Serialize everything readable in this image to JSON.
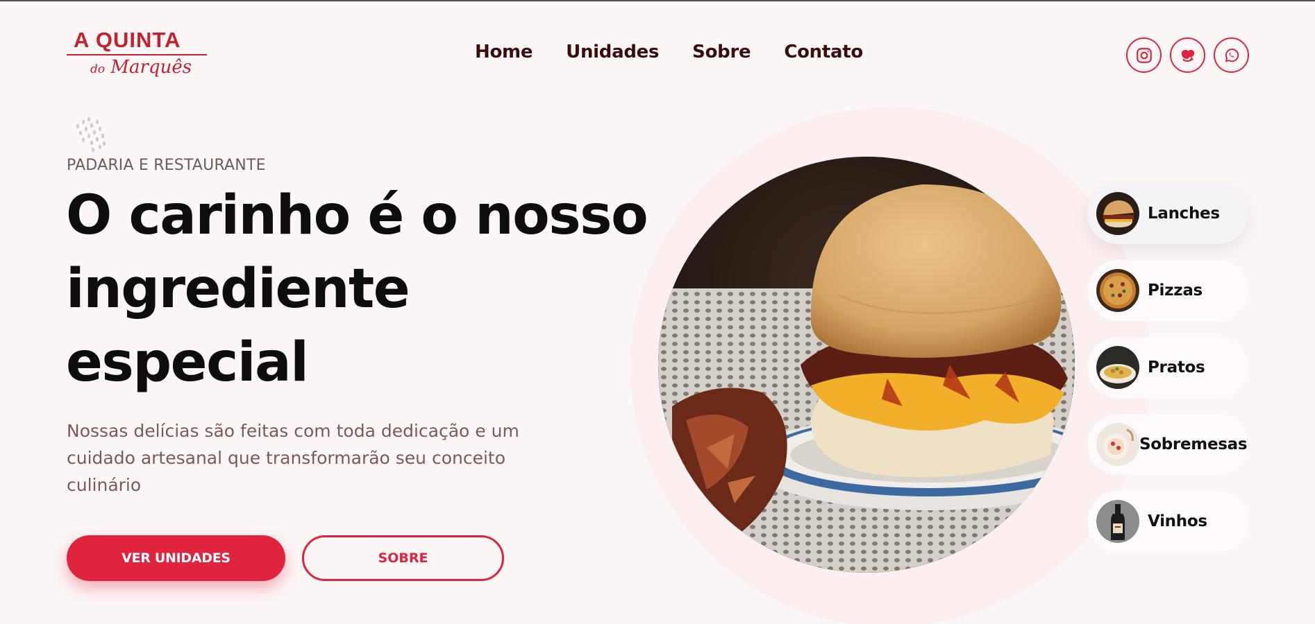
{
  "brand": {
    "logo_line1": "A QUINTA",
    "logo_line2_prefix": "do",
    "logo_line2": "Marquês",
    "primary_color": "#e0243d"
  },
  "nav": {
    "items": [
      {
        "label": "Home"
      },
      {
        "label": "Unidades"
      },
      {
        "label": "Sobre"
      },
      {
        "label": "Contato"
      }
    ]
  },
  "socials": [
    {
      "icon": "instagram-icon"
    },
    {
      "icon": "ifood-icon"
    },
    {
      "icon": "whatsapp-icon"
    }
  ],
  "hero": {
    "kicker": "PADARIA E RESTAURANTE",
    "headline": [
      "O carinho é o nosso",
      "ingrediente",
      "especial"
    ],
    "lead": "Nossas delícias são feitas com toda dedicação e um cuidado artesanal que transformarão seu conceito culinário",
    "primary_button": "VER UNIDADES",
    "secondary_button": "SOBRE"
  },
  "categories": [
    {
      "label": "Lanches",
      "active": true
    },
    {
      "label": "Pizzas",
      "active": false
    },
    {
      "label": "Pratos",
      "active": false
    },
    {
      "label": "Sobremesas",
      "active": false
    },
    {
      "label": "Vinhos",
      "active": false
    }
  ]
}
